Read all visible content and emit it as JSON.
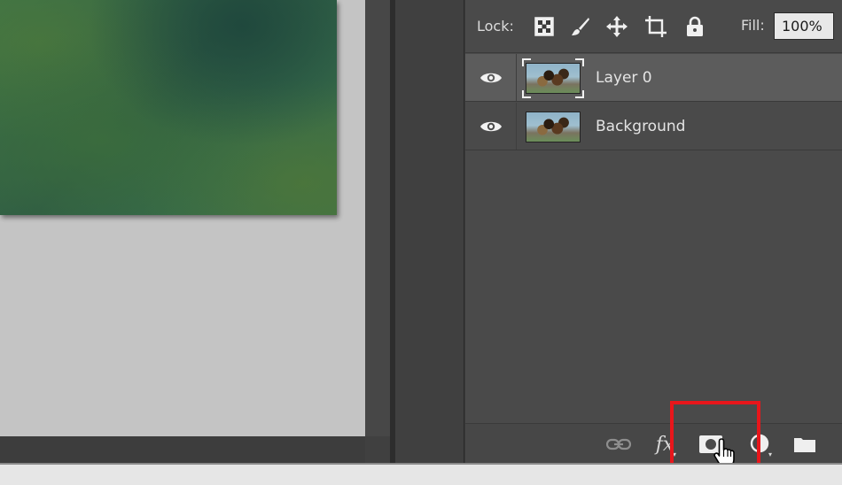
{
  "layers_panel": {
    "lock_label": "Lock:",
    "lock_icons": [
      "lock-transparent-pixels-icon",
      "lock-image-pixels-icon",
      "lock-position-icon",
      "lock-artboard-icon",
      "lock-all-icon"
    ],
    "fill_label": "Fill:",
    "fill_value": "100%",
    "layers": [
      {
        "name": "Layer 0",
        "visible": true,
        "selected": true
      },
      {
        "name": "Background",
        "visible": true,
        "selected": false
      }
    ],
    "footer_icons": [
      "link-layers-icon",
      "fx-icon",
      "add-layer-mask-icon",
      "adjustment-layer-icon",
      "new-group-folder-icon"
    ],
    "fx_label": "fx"
  },
  "annotation": {
    "highlight_color": "#e8161b",
    "highlighted_control": "add-layer-mask-icon"
  },
  "colors": {
    "panel_bg": "#4a4a4a",
    "selected_row": "#5c5c5c",
    "canvas_bg": "#c4c4c4"
  }
}
